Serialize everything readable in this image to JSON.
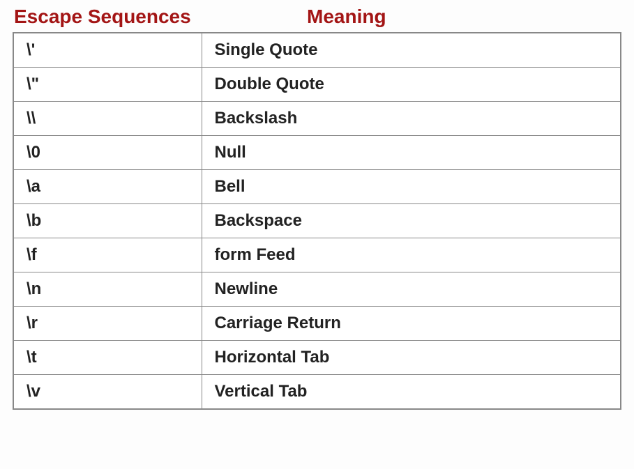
{
  "headers": {
    "sequences": "Escape Sequences",
    "meaning": "Meaning"
  },
  "rows": [
    {
      "seq": "\\'",
      "meaning": "Single Quote"
    },
    {
      "seq": "\\\"",
      "meaning": "Double Quote"
    },
    {
      "seq": "\\\\",
      "meaning": "Backslash"
    },
    {
      "seq": "\\0",
      "meaning": "Null"
    },
    {
      "seq": "\\a",
      "meaning": "Bell"
    },
    {
      "seq": "\\b",
      "meaning": "Backspace"
    },
    {
      "seq": "\\f",
      "meaning": "form Feed"
    },
    {
      "seq": "\\n",
      "meaning": "Newline"
    },
    {
      "seq": "\\r",
      "meaning": "Carriage Return"
    },
    {
      "seq": "\\t",
      "meaning": "Horizontal Tab"
    },
    {
      "seq": "\\v",
      "meaning": "Vertical Tab"
    }
  ]
}
